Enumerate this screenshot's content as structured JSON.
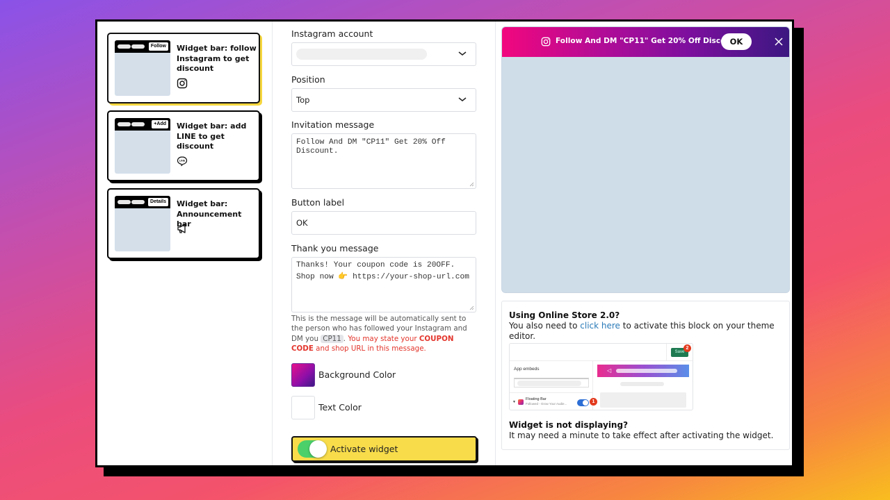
{
  "templates": [
    {
      "title": "Widget bar: follow Instagram to get discount",
      "mini_button": "Follow",
      "icon": "instagram-icon",
      "selected": true
    },
    {
      "title": "Widget bar: add LINE to get discount",
      "mini_button": "+Add",
      "icon": "line-icon",
      "selected": false
    },
    {
      "title": "Widget bar: Announcement bar",
      "mini_button": "Details",
      "icon": "megaphone-icon",
      "selected": false
    }
  ],
  "form": {
    "instagram_account": {
      "label": "Instagram account",
      "value": ""
    },
    "position": {
      "label": "Position",
      "value": "Top"
    },
    "invitation_message": {
      "label": "Invitation message",
      "value": "Follow And DM \"CP11\" Get 20% Off\nDiscount."
    },
    "button_label": {
      "label": "Button label",
      "value": "OK"
    },
    "thank_you_message": {
      "label": "Thank you message",
      "value": "Thanks! Your coupon code is 20OFF.\nShop now 👉 https://your-shop-url.com"
    },
    "helper": {
      "part1": "This is the message will be automatically sent to the person who has followed your Instagram and DM you ",
      "code": "CP11",
      "part2": ". ",
      "warn1": "You may state your ",
      "warn_bold": "COUPON CODE",
      "warn2": " and shop URL in this message."
    },
    "background_color": {
      "label": "Background Color",
      "value": "#e8108c → #3d1a86"
    },
    "text_color": {
      "label": "Text Color",
      "value": "#ffffff"
    },
    "activate": {
      "label": "Activate widget",
      "on": true
    }
  },
  "preview": {
    "message": "Follow And DM \"CP11\" Get 20% Off Discount.",
    "button": "OK",
    "colors": {
      "bar_start": "#f2077e",
      "bar_end": "#3b1781",
      "canvas": "#cfdde9"
    }
  },
  "info": {
    "os2_title": "Using Online Store 2.0?",
    "os2_text_before": "You also need to ",
    "os2_link": "click here",
    "os2_text_after": " to activate this block on your theme editor.",
    "screenshot": {
      "save": "Save",
      "badge_save": "2",
      "app_embeds": "App embeds",
      "floating_bar": "Floating Bar",
      "floating_sub": "Followed - Grow Your Audie...",
      "badge_toggle": "1"
    },
    "not_displaying_title": "Widget is not displaying?",
    "not_displaying_text": "It may need a minute to take effect after activating the widget."
  },
  "colors": {
    "accent_yellow": "#f8dc4a",
    "toggle_green": "#4bd06a",
    "warning_red": "#e3352c",
    "link_blue": "#2a7ab8"
  }
}
